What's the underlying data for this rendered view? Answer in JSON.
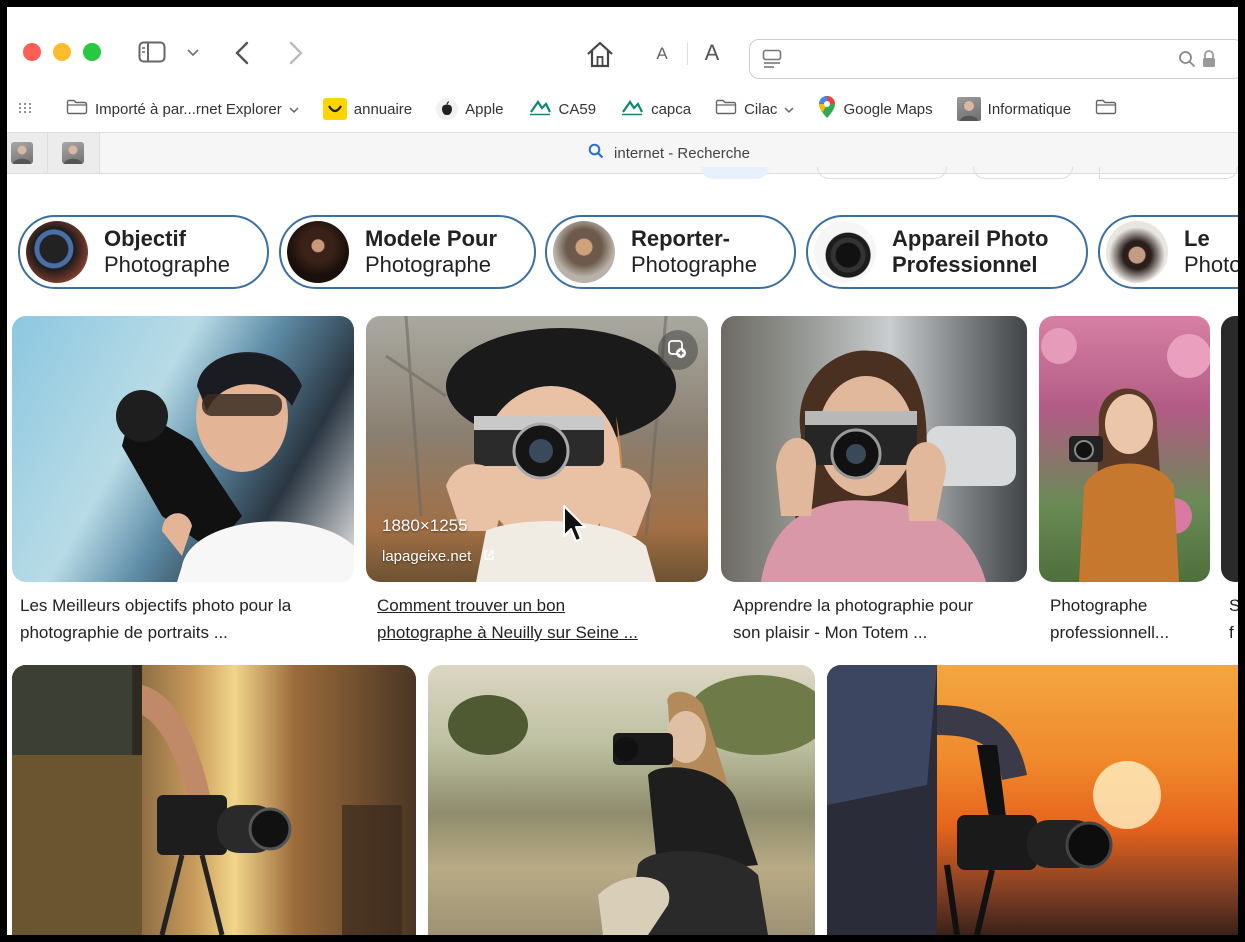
{
  "favorites": [
    {
      "icon": "folder-icon",
      "label": "Importé à par...rnet Explorer",
      "chevron": true
    },
    {
      "icon": "annuaire-smiley-icon",
      "label": "annuaire",
      "chevron": false
    },
    {
      "icon": "apple-icon",
      "label": "Apple",
      "chevron": false
    },
    {
      "icon": "ca-bank-icon",
      "label": "CA59",
      "chevron": false
    },
    {
      "icon": "ca-bank-icon",
      "label": "capca",
      "chevron": false
    },
    {
      "icon": "folder-icon",
      "label": "Cilac",
      "chevron": true
    },
    {
      "icon": "google-maps-pin-icon",
      "label": "Google Maps",
      "chevron": false
    },
    {
      "icon": "person-thumbnail-icon",
      "label": "Informatique",
      "chevron": false
    }
  ],
  "toolbar": {
    "font_small": "A",
    "font_large": "A"
  },
  "tab": {
    "title": "internet - Recherche"
  },
  "chips": [
    {
      "line1": "Objectif",
      "line2": "Photographe"
    },
    {
      "line1": "Modele Pour",
      "line2": "Photographe"
    },
    {
      "line1": "Reporter-",
      "line2": "Photographe"
    },
    {
      "line1": "Appareil Photo",
      "line2": "Professionnel"
    },
    {
      "line1": "Le",
      "line2": "Photo"
    }
  ],
  "results": [
    {
      "caption_1": "Les Meilleurs objectifs photo pour la",
      "caption_2": "photographie de portraits ..."
    },
    {
      "caption_1": "Comment trouver un bon",
      "caption_2": "photographe à Neuilly sur Seine ...",
      "dimensions": "1880×1255",
      "source": "lapageixe.net"
    },
    {
      "caption_1": "Apprendre la photographie pour",
      "caption_2": "son plaisir - Mon Totem ..."
    },
    {
      "caption_1": "Photographe",
      "caption_2": "professionnell..."
    }
  ],
  "colors": {
    "chip_border": "#3b6fa0",
    "close": "#ff5f57",
    "minimize": "#febc2e",
    "zoom": "#28c840"
  }
}
